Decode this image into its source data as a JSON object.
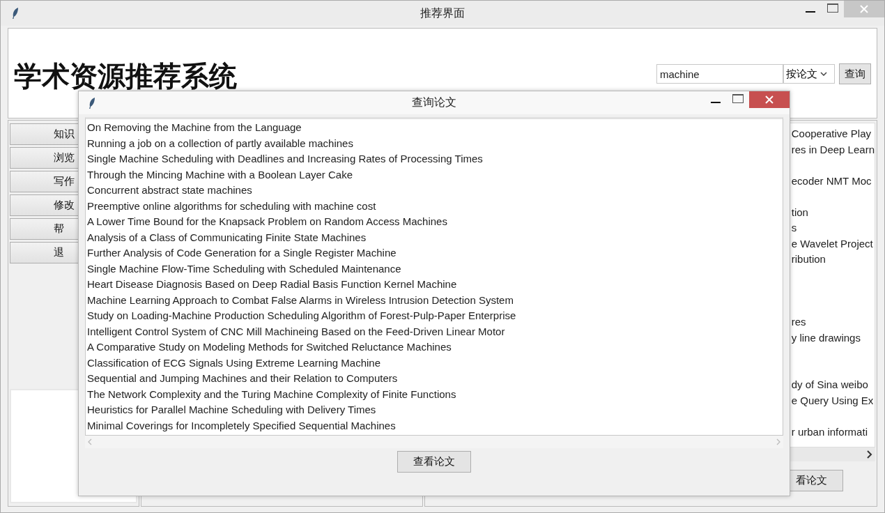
{
  "window": {
    "title": "推荐界面"
  },
  "header": {
    "title": "学术资源推荐系统",
    "search": {
      "value": "machine"
    },
    "search_mode": {
      "value": "按论文"
    },
    "search_button": "查询"
  },
  "menu_buttons": [
    "知识",
    "浏览",
    "写作",
    "修改",
    "帮",
    "退"
  ],
  "right_list": [
    "Cooperative Play",
    "res in Deep Learn",
    "ecoder NMT Moc",
    "tion",
    "s",
    "e Wavelet Project",
    "ribution",
    "res",
    "y line drawings",
    "dy of Sina weibo",
    "e Query Using Ex",
    "r urban informati"
  ],
  "right_button": "看论文",
  "dialog": {
    "title": "查询论文",
    "papers": [
      {
        "title": "On Removing the Machine from the Language",
        "selected": false
      },
      {
        "title": "Running a job on a collection of partly available machines",
        "selected": false
      },
      {
        "title": "Single Machine Scheduling with Deadlines and Increasing Rates of Processing Times",
        "selected": false
      },
      {
        "title": "Through the Mincing Machine with a Boolean Layer Cake",
        "selected": false
      },
      {
        "title": "Concurrent abstract state machines",
        "selected": false
      },
      {
        "title": "Preemptive online algorithms for scheduling with machine cost",
        "selected": false
      },
      {
        "title": "A Lower Time Bound for the Knapsack Problem on Random Access Machines",
        "selected": false
      },
      {
        "title": "Analysis of a Class of Communicating Finite State Machines",
        "selected": false
      },
      {
        "title": "Further Analysis of Code Generation for a Single Register Machine",
        "selected": false
      },
      {
        "title": "Single Machine Flow-Time Scheduling with Scheduled Maintenance",
        "selected": false
      },
      {
        "title": "Heart Disease Diagnosis Based on Deep Radial Basis Function Kernel Machine",
        "selected": false
      },
      {
        "title": "Machine Learning Approach to Combat False Alarms in Wireless Intrusion Detection System",
        "selected": false
      },
      {
        "title": "Study on Loading-Machine Production Scheduling Algorithm of Forest-Pulp-Paper Enterprise",
        "selected": false
      },
      {
        "title": "Intelligent Control System of CNC Mill Machineing Based on the Feed-Driven Linear Motor",
        "selected": false
      },
      {
        "title": "A Comparative Study on Modeling Methods for Switched Reluctance Machines",
        "selected": false
      },
      {
        "title": "Classification of ECG Signals Using Extreme Learning Machine",
        "selected": false
      },
      {
        "title": "Sequential and Jumping Machines and their Relation to Computers",
        "selected": false
      },
      {
        "title": "The Network Complexity and the Turing Machine Complexity of Finite Functions",
        "selected": false
      },
      {
        "title": "Heuristics for Parallel Machine Scheduling with Delivery Times",
        "selected": false
      },
      {
        "title": "Minimal Coverings for Incompletely Specified Sequential Machines",
        "selected": false
      }
    ],
    "button": "查看论文"
  }
}
